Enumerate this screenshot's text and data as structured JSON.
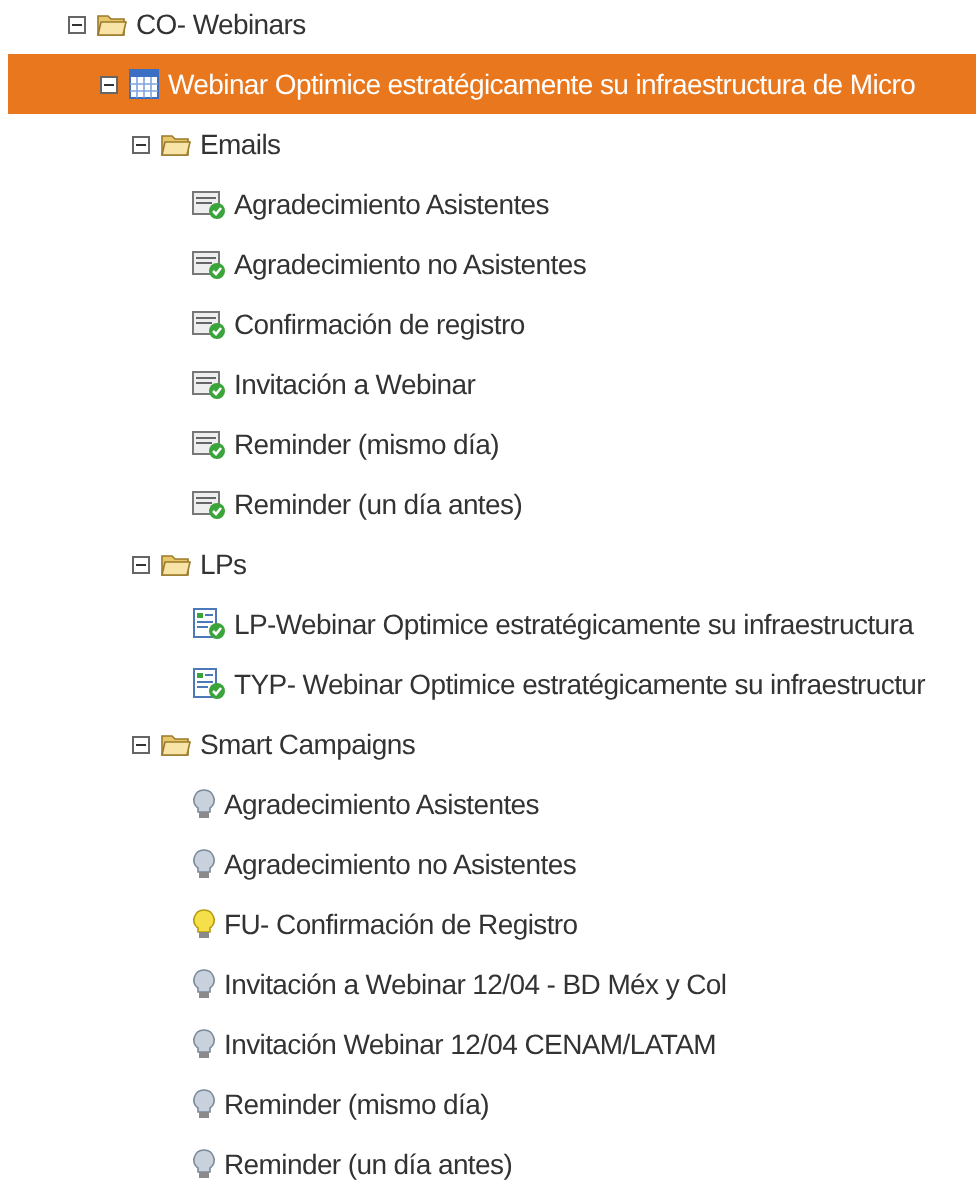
{
  "tree": [
    {
      "kind": "folder",
      "label": "CO- Webinars",
      "expanded": true,
      "selected": false,
      "children": [
        {
          "kind": "program",
          "label": "Webinar Optimice estratégicamente su infraestructura de Micro",
          "expanded": true,
          "selected": true,
          "children": [
            {
              "kind": "folder",
              "label": "Emails",
              "expanded": true,
              "selected": false,
              "children": [
                {
                  "kind": "email",
                  "label": "Agradecimiento Asistentes",
                  "selected": false
                },
                {
                  "kind": "email",
                  "label": "Agradecimiento no Asistentes",
                  "selected": false
                },
                {
                  "kind": "email",
                  "label": "Confirmación de registro",
                  "selected": false
                },
                {
                  "kind": "email",
                  "label": "Invitación a Webinar",
                  "selected": false
                },
                {
                  "kind": "email",
                  "label": "Reminder (mismo día)",
                  "selected": false
                },
                {
                  "kind": "email",
                  "label": "Reminder (un día antes)",
                  "selected": false
                }
              ]
            },
            {
              "kind": "folder",
              "label": "LPs",
              "expanded": true,
              "selected": false,
              "children": [
                {
                  "kind": "landing-page",
                  "label": "LP-Webinar Optimice estratégicamente su infraestructura",
                  "selected": false
                },
                {
                  "kind": "landing-page",
                  "label": "TYP- Webinar Optimice estratégicamente su infraestructur",
                  "selected": false
                }
              ]
            },
            {
              "kind": "folder",
              "label": "Smart Campaigns",
              "expanded": true,
              "selected": false,
              "children": [
                {
                  "kind": "campaign",
                  "label": "Agradecimiento Asistentes",
                  "active": false,
                  "selected": false
                },
                {
                  "kind": "campaign",
                  "label": "Agradecimiento no Asistentes",
                  "active": false,
                  "selected": false
                },
                {
                  "kind": "campaign",
                  "label": "FU- Confirmación de Registro",
                  "active": true,
                  "selected": false
                },
                {
                  "kind": "campaign",
                  "label": "Invitación a Webinar 12/04 - BD Méx y Col",
                  "active": false,
                  "selected": false
                },
                {
                  "kind": "campaign",
                  "label": "Invitación Webinar 12/04 CENAM/LATAM",
                  "active": false,
                  "selected": false
                },
                {
                  "kind": "campaign",
                  "label": "Reminder (mismo día)",
                  "active": false,
                  "selected": false
                },
                {
                  "kind": "campaign",
                  "label": "Reminder (un día antes)",
                  "active": false,
                  "selected": false
                }
              ]
            }
          ]
        }
      ]
    }
  ]
}
